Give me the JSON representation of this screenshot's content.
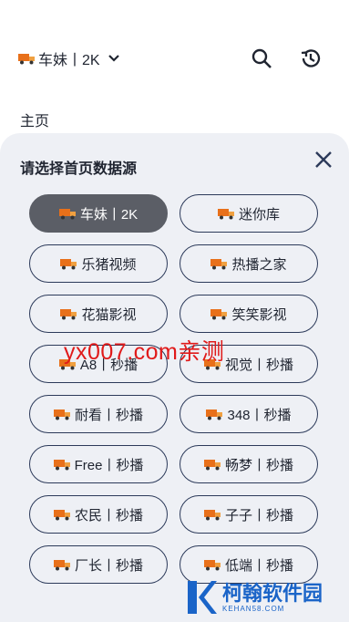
{
  "header": {
    "source_label": "车妹丨2K",
    "icons": {
      "source": "truck-icon",
      "dropdown": "chevron-down-icon",
      "search": "search-icon",
      "history": "history-icon"
    }
  },
  "home_label": "主页",
  "sheet": {
    "title": "请选择首页数据源",
    "close_icon": "close-icon",
    "chips": [
      {
        "label": "车妹丨2K",
        "selected": true
      },
      {
        "label": "迷你库",
        "selected": false
      },
      {
        "label": "乐猪视频",
        "selected": false
      },
      {
        "label": "热播之家",
        "selected": false
      },
      {
        "label": "花猫影视",
        "selected": false
      },
      {
        "label": "笑笑影视",
        "selected": false
      },
      {
        "label": "A8丨秒播",
        "selected": false
      },
      {
        "label": "视觉丨秒播",
        "selected": false
      },
      {
        "label": "耐看丨秒播",
        "selected": false
      },
      {
        "label": "348丨秒播",
        "selected": false
      },
      {
        "label": "Free丨秒播",
        "selected": false
      },
      {
        "label": "畅梦丨秒播",
        "selected": false
      },
      {
        "label": "农民丨秒播",
        "selected": false
      },
      {
        "label": "子子丨秒播",
        "selected": false
      },
      {
        "label": "厂长丨秒播",
        "selected": false
      },
      {
        "label": "低端丨秒播",
        "selected": false
      }
    ]
  },
  "watermark": "yx007.com亲测",
  "logo": {
    "main": "柯翰软件园",
    "sub": "KEHAN58.COM"
  },
  "colors": {
    "accent": "#2c3a5a",
    "selected_chip": "#5b5e66",
    "sheet_bg": "#eef0f5",
    "watermark": "#e01a1a",
    "logo": "#1a64c8",
    "truck": "#e8701a"
  }
}
